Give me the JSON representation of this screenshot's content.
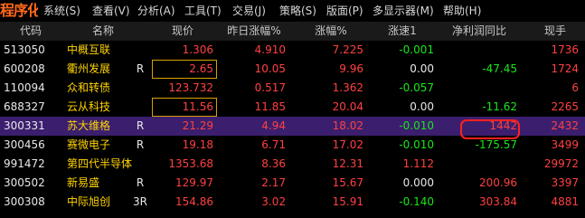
{
  "menu": {
    "logo": "程序化",
    "items": [
      "系统(S)",
      "查看(V)",
      "分析(A)",
      "工具(T)",
      "交易(J)",
      "策略(S)",
      "版面(P)",
      "多显示器(M)",
      "帮助(H)"
    ]
  },
  "table": {
    "headers": [
      "代码",
      "名称",
      "现价",
      "昨日涨幅%",
      "涨幅%",
      "涨速1",
      "净利润同比",
      "现手"
    ],
    "rows": [
      {
        "code": "513050",
        "name": "中概互联",
        "flag": "",
        "price": "1.306",
        "prev_chg": "4.910",
        "pct": "7.225",
        "speed": "-0.001",
        "net_profit": "",
        "volume": "1736"
      },
      {
        "code": "600208",
        "name": "衢州发展",
        "flag": "R",
        "price": "2.65",
        "prev_chg": "10.05",
        "pct": "9.96",
        "speed": "0.00",
        "net_profit": "-47.45",
        "volume": "1724"
      },
      {
        "code": "110094",
        "name": "众和转债",
        "flag": "",
        "price": "123.732",
        "prev_chg": "0.517",
        "pct": "1.362",
        "speed": "-0.057",
        "net_profit": "",
        "volume": "6"
      },
      {
        "code": "688327",
        "name": "云从科技",
        "flag": "",
        "price": "11.56",
        "prev_chg": "11.85",
        "pct": "20.04",
        "speed": "0.00",
        "net_profit": "-11.62",
        "volume": "2265"
      },
      {
        "code": "300331",
        "name": "苏大维格",
        "flag": "R",
        "price": "21.29",
        "prev_chg": "4.94",
        "pct": "18.02",
        "speed": "-0.010",
        "net_profit": "1442",
        "volume": "2432"
      },
      {
        "code": "300456",
        "name": "赛微电子",
        "flag": "R",
        "price": "19.18",
        "prev_chg": "6.71",
        "pct": "17.02",
        "speed": "-0.010",
        "net_profit": "-175.57",
        "volume": "3499"
      },
      {
        "code": "991472",
        "name": "第四代半导体",
        "flag": "",
        "price": "1353.68",
        "prev_chg": "8.36",
        "pct": "12.31",
        "speed": "1.112",
        "net_profit": "",
        "volume": "29972"
      },
      {
        "code": "300502",
        "name": "新易盛",
        "flag": "R",
        "price": "129.97",
        "prev_chg": "2.17",
        "pct": "15.67",
        "speed": "0.000",
        "net_profit": "200.96",
        "volume": "3397"
      },
      {
        "code": "300308",
        "name": "中际旭创",
        "flag": "3R",
        "price": "154.86",
        "prev_chg": "3.02",
        "pct": "15.91",
        "speed": "-0.140",
        "net_profit": "303.84",
        "volume": "4881"
      }
    ]
  },
  "colors": {
    "up": "#ff4040",
    "down": "#19e619",
    "name": "#ffd400",
    "selected_row": "#3b1f6e",
    "annotation": "#ff2020"
  }
}
